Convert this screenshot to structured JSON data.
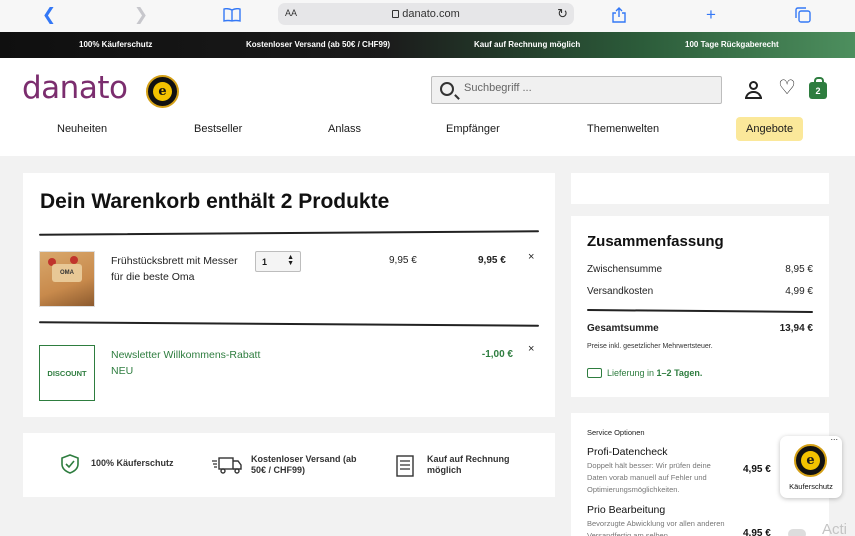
{
  "browser": {
    "text_size": "AA",
    "url": "danato.com"
  },
  "promo": [
    "100% Käuferschutz",
    "Kostenloser Versand (ab 50€ / CHF99)",
    "Kauf auf Rechnung möglich",
    "100 Tage Rückgaberecht"
  ],
  "header": {
    "logo": "danato",
    "search_placeholder": "Suchbegriff ...",
    "cart_count": "2"
  },
  "nav": [
    "Neuheiten",
    "Bestseller",
    "Anlass",
    "Empfänger",
    "Themenwelten",
    "Angebote"
  ],
  "cart": {
    "title": "Dein Warenkorb enthält 2 Produkte",
    "item": {
      "image_label": "OMA",
      "name": "Frühstücksbrett mit Messer für die beste Oma",
      "quantity": "1",
      "unit_price": "9,95 €",
      "total": "9,95 €",
      "remove": "×"
    },
    "discount": {
      "badge": "DISCOUNT",
      "name": "Newsletter Willkommens-Rabatt NEU",
      "value": "-1,00 €",
      "remove": "×"
    }
  },
  "trust": [
    "100% Käuferschutz",
    "Kostenloser Versand (ab 50€ / CHF99)",
    "Kauf auf Rechnung möglich"
  ],
  "summary": {
    "title": "Zusammenfassung",
    "subtotal_label": "Zwischensumme",
    "subtotal": "8,95 €",
    "shipping_label": "Versandkosten",
    "shipping": "4,99 €",
    "total_label": "Gesamtsumme",
    "total": "13,94 €",
    "tax_note": "Preise inkl. gesetzlicher Mehrwertsteuer.",
    "delivery_prefix": "Lieferung in ",
    "delivery_days": "1–2 Tagen."
  },
  "services": {
    "header": "Service Optionen",
    "items": [
      {
        "name": "Profi-Datencheck",
        "desc": "Doppelt hält besser: Wir prüfen deine Daten vorab manuell auf Fehler und Optimierungsmöglichkeiten.",
        "price": "4,95 €"
      },
      {
        "name": "Prio Bearbeitung",
        "desc": "Bevorzugte Abwicklung vor allen anderen Versandfertig am selben",
        "price": "4,95 €"
      }
    ]
  },
  "widget": {
    "label": "Käuferschutz",
    "seal_letter": "e",
    "dots": "..."
  },
  "overlay_text": "Acti",
  "colors": {
    "brand": "#7b2d6e",
    "accent_green": "#2e7d3f",
    "highlight": "#fbe89a"
  }
}
